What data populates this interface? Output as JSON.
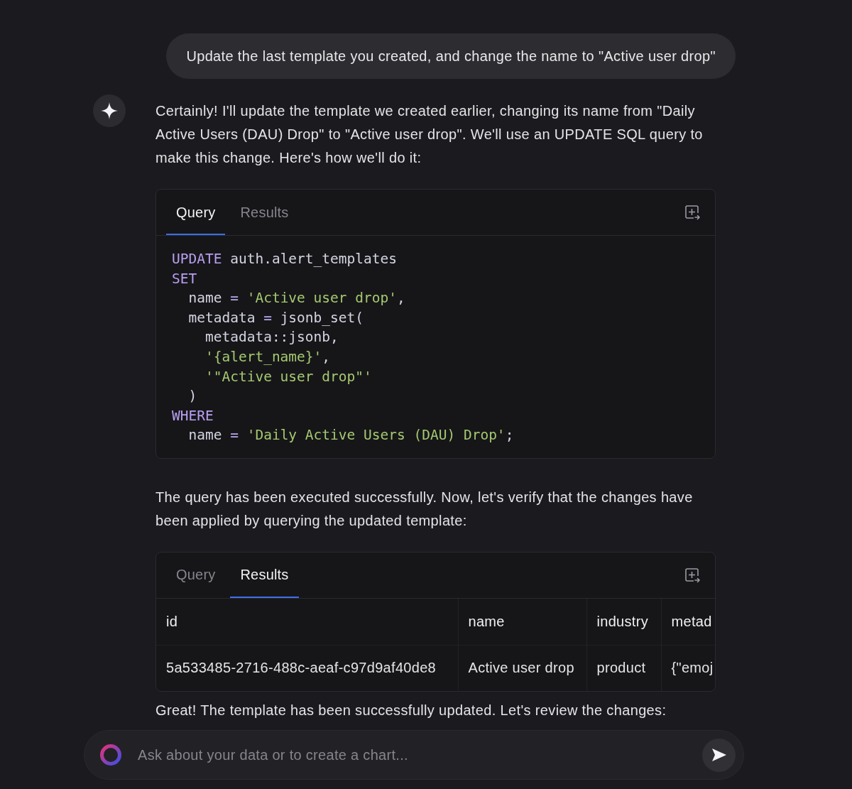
{
  "user_message": {
    "text": "Update the last template you created, and change the name to \"Active user drop\""
  },
  "assistant": {
    "blocks": [
      {
        "kind": "paragraph",
        "text": "Certainly! I'll update the template we created earlier, changing its name from \"Daily Active Users (DAU) Drop\" to \"Active user drop\". We'll use an UPDATE SQL query to make this change. Here's how we'll do it:"
      },
      {
        "kind": "query_card",
        "tabs": [
          {
            "label": "Query",
            "selected": true
          },
          {
            "label": "Results",
            "selected": false
          }
        ],
        "code": [
          [
            {
              "kind": "keyword",
              "text": "UPDATE"
            },
            {
              "kind": "plain",
              "text": " auth.alert_templates"
            }
          ],
          [
            {
              "kind": "keyword",
              "text": "SET"
            }
          ],
          [
            {
              "kind": "plain",
              "text": "  name "
            },
            {
              "kind": "operator",
              "text": "= "
            },
            {
              "kind": "string",
              "text": "'Active user drop'"
            },
            {
              "kind": "plain",
              "text": ","
            }
          ],
          [
            {
              "kind": "plain",
              "text": "  metadata "
            },
            {
              "kind": "operator",
              "text": "="
            },
            {
              "kind": "plain",
              "text": " jsonb_set("
            }
          ],
          [
            {
              "kind": "plain",
              "text": "    metadata::jsonb,"
            }
          ],
          [
            {
              "kind": "string",
              "text": "    '{alert_name}'"
            },
            {
              "kind": "plain",
              "text": ","
            }
          ],
          [
            {
              "kind": "string",
              "text": "    '\"Active user drop\"'"
            }
          ],
          [
            {
              "kind": "plain",
              "text": "  )"
            }
          ],
          [
            {
              "kind": "keyword",
              "text": "WHERE"
            }
          ],
          [
            {
              "kind": "plain",
              "text": "  name "
            },
            {
              "kind": "operator",
              "text": "= "
            },
            {
              "kind": "string",
              "text": "'Daily Active Users (DAU) Drop'"
            },
            {
              "kind": "plain",
              "text": ";"
            }
          ]
        ]
      },
      {
        "kind": "paragraph",
        "text": "The query has been executed successfully. Now, let's verify that the changes have been applied by querying the updated template:"
      },
      {
        "kind": "query_card",
        "tabs": [
          {
            "label": "Query",
            "selected": false
          },
          {
            "label": "Results",
            "selected": true
          }
        ],
        "table": {
          "columns": [
            "id",
            "name",
            "industry",
            "metad"
          ],
          "rows": [
            [
              "5a533485-2716-488c-aeaf-c97d9af40de8",
              "Active user drop",
              "product",
              "{\"emoj"
            ]
          ]
        }
      },
      {
        "kind": "paragraph",
        "text": "Great! The template has been successfully updated. Let's review the changes:"
      }
    ]
  },
  "composer": {
    "placeholder": "Ask about your data or to create a chart..."
  }
}
